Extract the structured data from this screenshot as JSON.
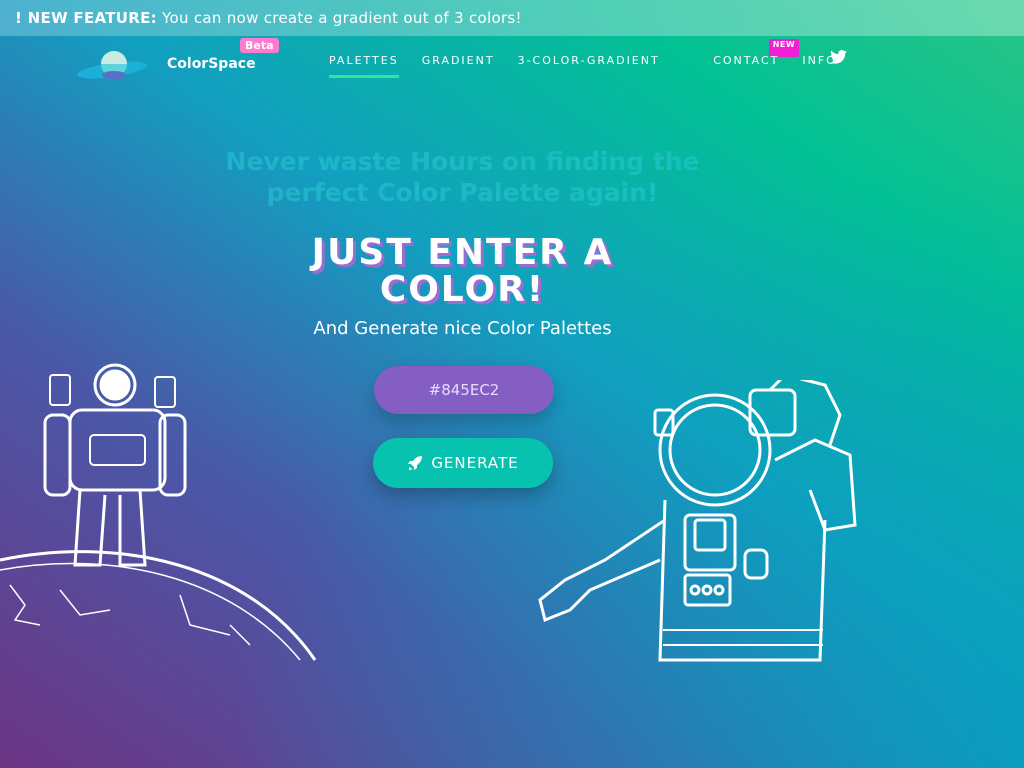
{
  "banner": {
    "prefix": "! NEW FEATURE:",
    "text": " You can now create a gradient out of 3 colors!"
  },
  "nav": {
    "brand": "ColorSpace",
    "beta": "Beta",
    "links": [
      "PALETTES",
      "GRADIENT",
      "3-COLOR-GRADIENT",
      "CONTACT",
      "INFO"
    ],
    "new_badge": "NEW",
    "active": "PALETTES"
  },
  "hero": {
    "tagline": "Never waste Hours on finding the perfect Color Palette again!",
    "title": "JUST ENTER A COLOR!",
    "subtitle": "And Generate nice Color Palettes"
  },
  "form": {
    "color_value": "#845EC2",
    "generate_label": "GENERATE"
  },
  "colors": {
    "input": "#845EC2",
    "button": "#08C2B0",
    "accent": "#2EE89A"
  }
}
